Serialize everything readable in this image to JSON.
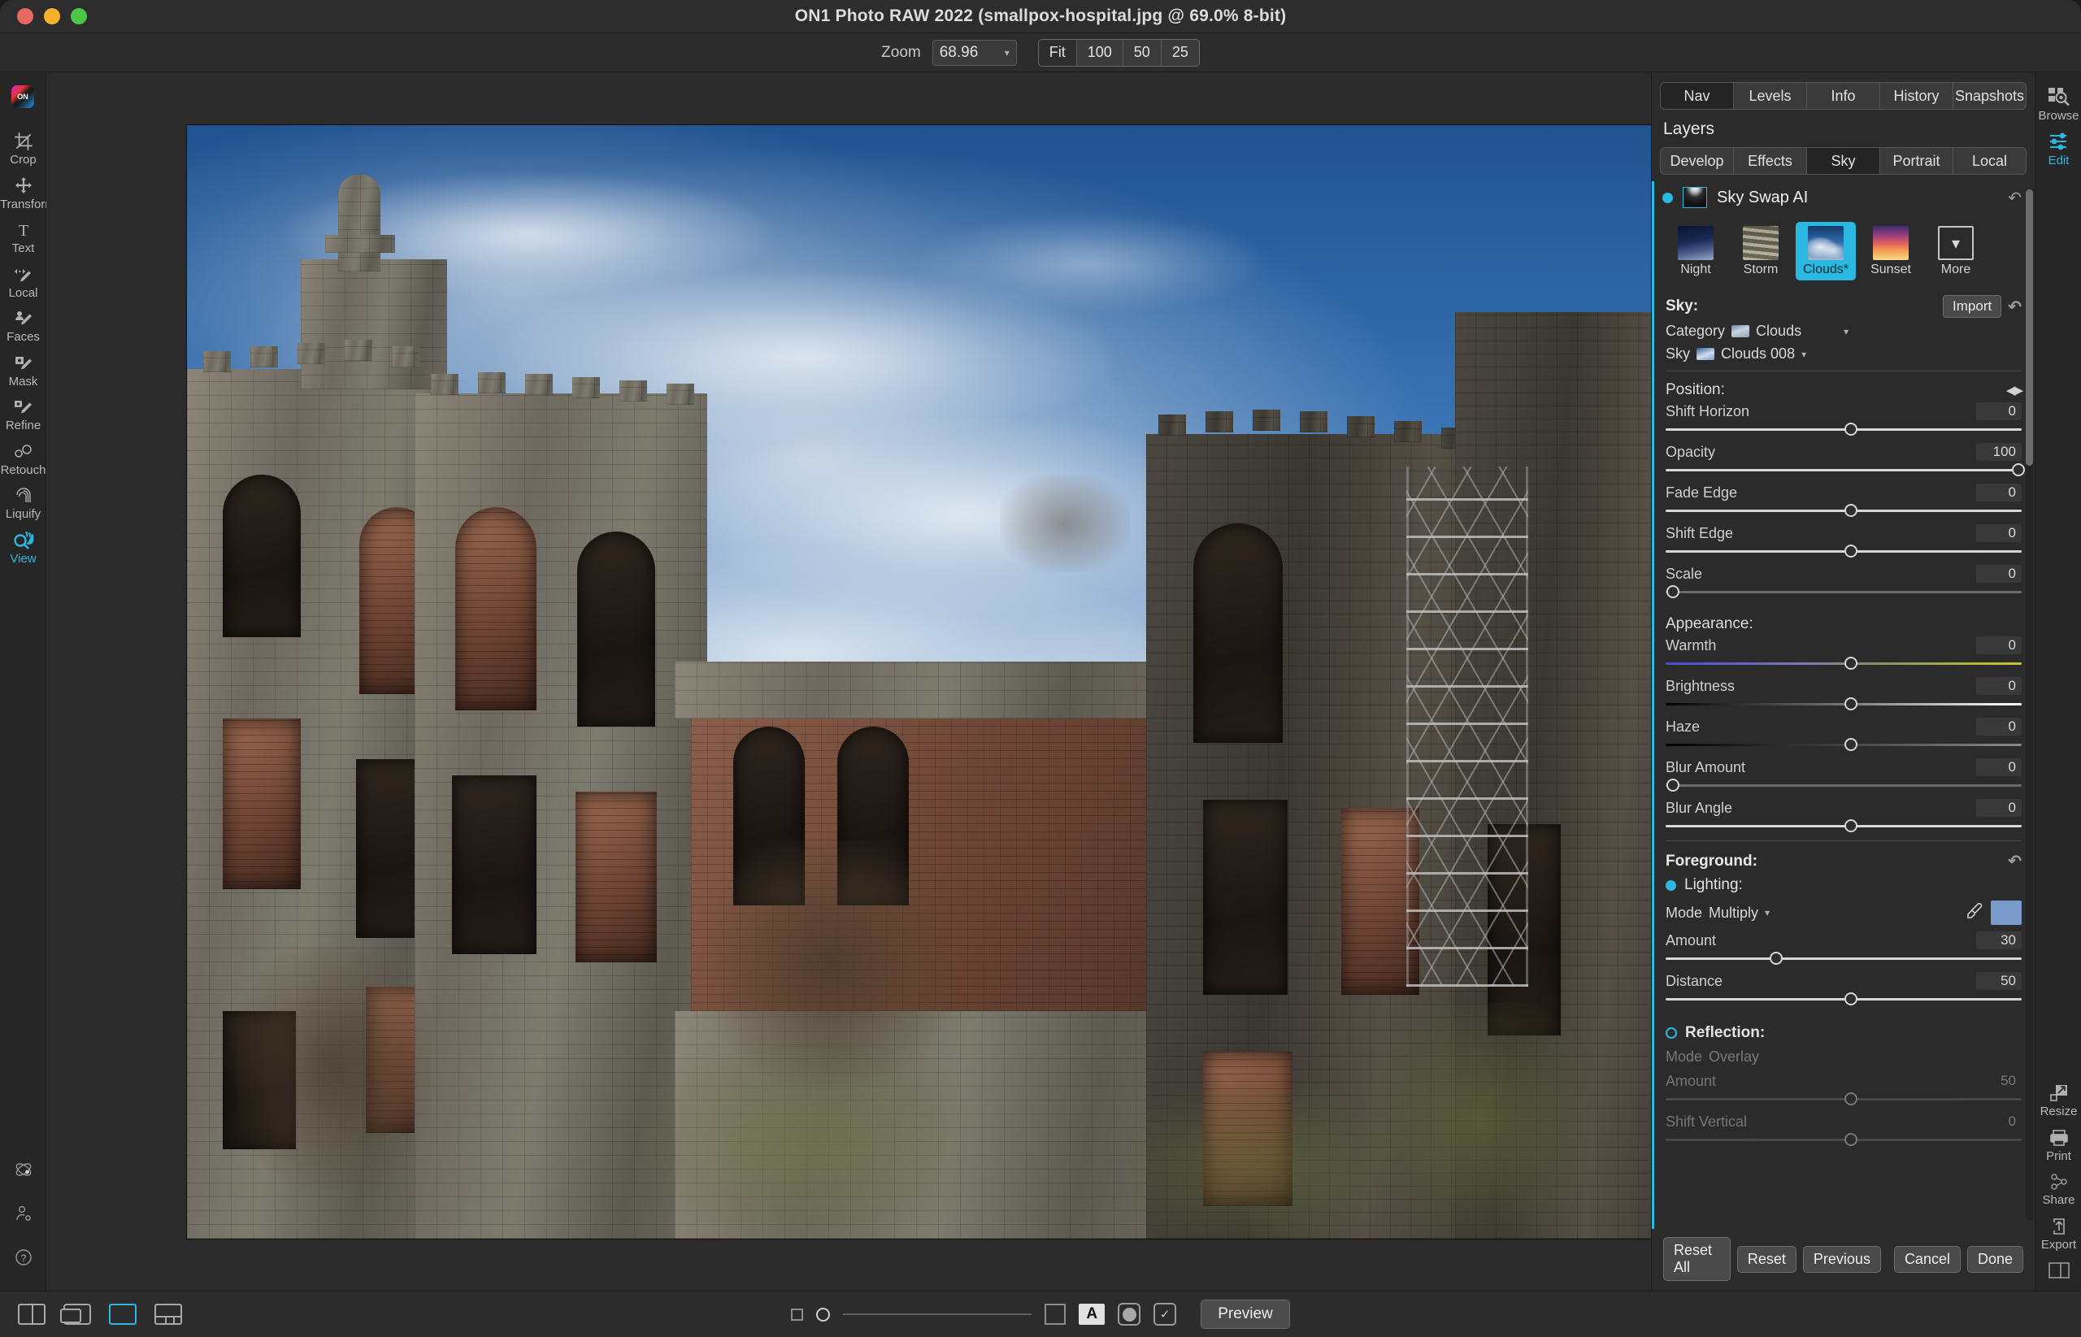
{
  "window": {
    "title": "ON1 Photo RAW 2022 (smallpox-hospital.jpg @ 69.0% 8-bit)"
  },
  "toolbar": {
    "zoom_label": "Zoom",
    "zoom_value": "68.96",
    "fit_options": [
      "Fit",
      "100",
      "50",
      "25"
    ]
  },
  "left_rail": {
    "tools": [
      {
        "label": "Crop",
        "icon": "crop-icon",
        "active": false
      },
      {
        "label": "Transform",
        "icon": "transform-icon",
        "active": false
      },
      {
        "label": "Text",
        "icon": "text-icon",
        "active": false
      },
      {
        "label": "Local",
        "icon": "local-brush-icon",
        "active": false
      },
      {
        "label": "Faces",
        "icon": "faces-icon",
        "active": false
      },
      {
        "label": "Mask",
        "icon": "mask-brush-icon",
        "active": false
      },
      {
        "label": "Refine",
        "icon": "refine-icon",
        "active": false
      },
      {
        "label": "Retouch",
        "icon": "retouch-icon",
        "active": false
      },
      {
        "label": "Liquify",
        "icon": "liquify-icon",
        "active": false
      },
      {
        "label": "View",
        "icon": "view-hand-magnifier-icon",
        "active": true
      }
    ],
    "bottom_icons": [
      "atom-icon",
      "user-settings-icon",
      "help-icon"
    ]
  },
  "right_rail": {
    "top": [
      {
        "label": "Browse",
        "icon": "browse-icon",
        "active": false
      },
      {
        "label": "Edit",
        "icon": "edit-sliders-icon",
        "active": true
      }
    ],
    "bottom": [
      {
        "label": "Resize",
        "icon": "resize-icon",
        "active": false
      },
      {
        "label": "Print",
        "icon": "printer-icon",
        "active": false
      },
      {
        "label": "Share",
        "icon": "share-icon",
        "active": false
      },
      {
        "label": "Export",
        "icon": "export-upload-icon",
        "active": false
      }
    ]
  },
  "panel": {
    "tabs": [
      {
        "label": "Nav",
        "selected": true
      },
      {
        "label": "Levels",
        "selected": false
      },
      {
        "label": "Info",
        "selected": false
      },
      {
        "label": "History",
        "selected": false
      },
      {
        "label": "Snapshots",
        "selected": false
      }
    ],
    "layers_title": "Layers",
    "modules": [
      {
        "label": "Develop",
        "selected": false
      },
      {
        "label": "Effects",
        "selected": false
      },
      {
        "label": "Sky",
        "selected": true
      },
      {
        "label": "Portrait",
        "selected": false
      },
      {
        "label": "Local",
        "selected": false
      }
    ],
    "layer": {
      "name": "Sky Swap AI",
      "enabled": true,
      "reset_icon": "reset-arrow-icon"
    },
    "presets": [
      {
        "label": "Night",
        "selected": false,
        "thumb": "th-night"
      },
      {
        "label": "Storm",
        "selected": false,
        "thumb": "th-storm"
      },
      {
        "label": "Clouds*",
        "selected": true,
        "thumb": "th-clouds"
      },
      {
        "label": "Sunset",
        "selected": false,
        "thumb": "th-sunset"
      },
      {
        "label": "More",
        "selected": false,
        "thumb": "th-more"
      }
    ],
    "sky_section": {
      "heading": "Sky:",
      "import_label": "Import",
      "reset_icon": "reset-arrow-icon",
      "category_label": "Category",
      "category_value": "Clouds",
      "sky_label": "Sky",
      "sky_value": "Clouds 008"
    },
    "position_section": {
      "heading": "Position:",
      "sliders": [
        {
          "label": "Shift Horizon",
          "value": "0",
          "pos": 52,
          "style": "filled"
        },
        {
          "label": "Opacity",
          "value": "100",
          "pos": 99,
          "style": "filled"
        },
        {
          "label": "Fade Edge",
          "value": "0",
          "pos": 52,
          "style": "filled"
        },
        {
          "label": "Shift Edge",
          "value": "0",
          "pos": 52,
          "style": "filled"
        },
        {
          "label": "Scale",
          "value": "0",
          "pos": 2,
          "style": "plain"
        }
      ]
    },
    "appearance_section": {
      "heading": "Appearance:",
      "sliders": [
        {
          "label": "Warmth",
          "value": "0",
          "pos": 52,
          "style": "warmth"
        },
        {
          "label": "Brightness",
          "value": "0",
          "pos": 52,
          "style": "bright"
        },
        {
          "label": "Haze",
          "value": "0",
          "pos": 52,
          "style": "haze"
        },
        {
          "label": "Blur Amount",
          "value": "0",
          "pos": 2,
          "style": "plain"
        },
        {
          "label": "Blur Angle",
          "value": "0",
          "pos": 52,
          "style": "filled"
        }
      ]
    },
    "foreground_section": {
      "heading": "Foreground:",
      "reset_icon": "reset-arrow-icon",
      "lighting_label": "Lighting:",
      "lighting_enabled": true,
      "mode_label": "Mode",
      "mode_value": "Multiply",
      "eyedropper_icon": "eyedropper-icon",
      "color_swatch": "#7a9acb",
      "sliders": [
        {
          "label": "Amount",
          "value": "30",
          "pos": 31,
          "style": "filled"
        },
        {
          "label": "Distance",
          "value": "50",
          "pos": 52,
          "style": "filled"
        }
      ]
    },
    "reflection_section": {
      "heading": "Reflection:",
      "enabled": false,
      "mode_label": "Mode",
      "mode_value": "Overlay",
      "sliders": [
        {
          "label": "Amount",
          "value": "50",
          "pos": 52,
          "style": "plain"
        },
        {
          "label": "Shift Vertical",
          "value": "0",
          "pos": 52,
          "style": "plain"
        }
      ]
    },
    "buttons": [
      {
        "label": "Reset All"
      },
      {
        "label": "Reset"
      },
      {
        "label": "Previous"
      },
      {
        "label": "Cancel"
      },
      {
        "label": "Done"
      }
    ]
  },
  "bottom_bar": {
    "view_modes": [
      {
        "icon": "compare-split-icon",
        "selected": false
      },
      {
        "icon": "multi-screen-icon",
        "selected": false
      },
      {
        "icon": "single-view-icon",
        "selected": true
      },
      {
        "icon": "grid-view-icon",
        "selected": false
      }
    ],
    "mask_square_icon": "mask-square-icon",
    "brush_slider_value": 0,
    "show_mask_icon": "show-mask-icon",
    "letter_a_icon": "letter-a-icon",
    "solid_circle_icon": "solid-circle-icon",
    "checklist_icon": "checklist-icon",
    "preview_label": "Preview"
  }
}
